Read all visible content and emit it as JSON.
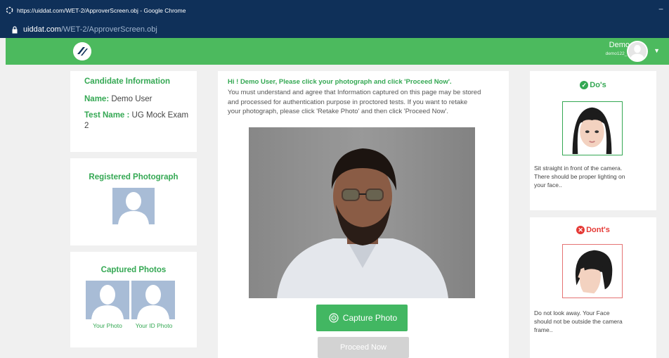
{
  "browser": {
    "title": "https://uiddat.com/WET-2/ApproverScreen.obj - Google Chrome",
    "url_domain": "uiddat.com",
    "url_path": "/WET-2/ApproverScreen.obj",
    "minimize": "−"
  },
  "header": {
    "user_name": "Demo",
    "user_id": "demo122_1",
    "brand_color": "#4cba5e"
  },
  "candidate": {
    "title": "Candidate Information",
    "name_label": "Name:",
    "name_value": "Demo User",
    "test_label": "Test Name :",
    "test_value_line1": "UG Mock Exam",
    "test_value_line2": "2"
  },
  "registered": {
    "title": "Registered Photograph"
  },
  "captured": {
    "title": "Captured Photos",
    "your_photo": "Your Photo",
    "your_id_photo": "Your ID Photo"
  },
  "instructions": {
    "heading": "Hi ! Demo User, Please click your photograph and click 'Proceed Now'.",
    "line1": "You must understand and agree that Information captured on this page may be stored",
    "line2": "and processed for authentication purpose in proctored tests. If you want to retake",
    "line3": "your photograph, please click 'Retake Photo' and then click 'Proceed Now'."
  },
  "buttons": {
    "capture": "Capture Photo",
    "proceed": "Proceed Now"
  },
  "dos": {
    "title": "Do's",
    "line1": "Sit straight in front of the camera.",
    "line2": "There should be proper lighting on",
    "line3": "your face.."
  },
  "donts": {
    "title": "Dont's",
    "line1": "Do not look away. Your Face",
    "line2": "should not be outside the camera",
    "line3": "frame.."
  }
}
